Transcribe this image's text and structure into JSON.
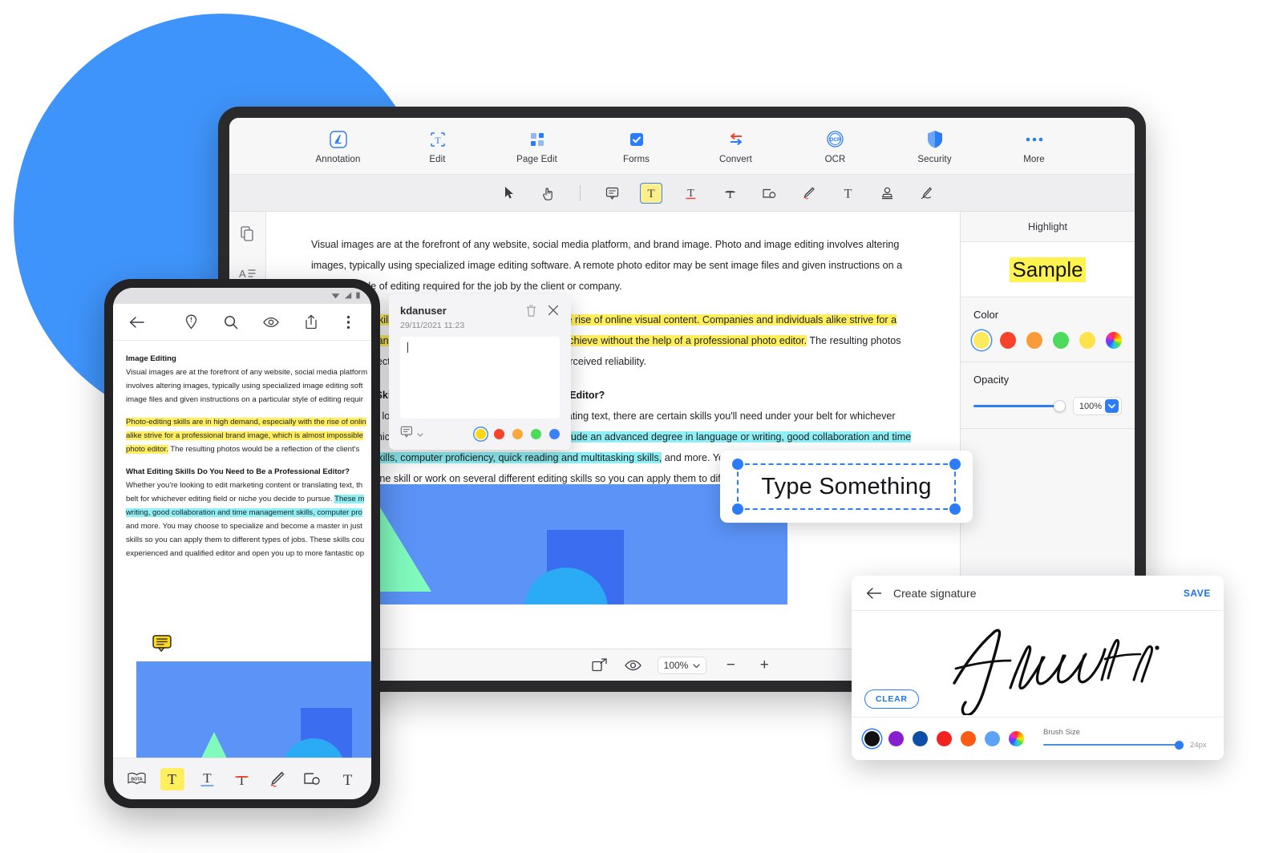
{
  "ribbon": {
    "items": [
      {
        "label": "Annotation",
        "icon": "annotation-icon",
        "active": true
      },
      {
        "label": "Edit",
        "icon": "edit-icon",
        "active": false
      },
      {
        "label": "Page Edit",
        "icon": "page-edit-icon",
        "active": false
      },
      {
        "label": "Forms",
        "icon": "forms-icon",
        "active": false
      },
      {
        "label": "Convert",
        "icon": "convert-icon",
        "active": false
      },
      {
        "label": "OCR",
        "icon": "ocr-icon",
        "active": false
      },
      {
        "label": "Security",
        "icon": "security-shield-icon",
        "active": false
      },
      {
        "label": "More",
        "icon": "more-dots-icon",
        "active": false
      }
    ]
  },
  "toolbar": {
    "tools": [
      "select-arrow-icon",
      "hand-icon",
      "separator",
      "sticky-note-icon",
      "highlight-text-icon",
      "underline-text-icon",
      "strikethrough-text-icon",
      "shapes-icon",
      "pencil-icon",
      "typewriter-icon",
      "stamp-icon",
      "signature-icon"
    ]
  },
  "left_rail": {
    "items": [
      "thumbnails-icon",
      "outline-icon"
    ]
  },
  "document": {
    "paragraph1": "Visual images are at the forefront of any website, social media platform, and brand image. Photo and image editing involves altering images, typically using specialized image editing software. A remote photo editor may be sent image files and given instructions on a particular style of editing required for the job by the client or company.",
    "paragraph2_hl1": "Photo-editing skills are in high demand, especially with the rise of online visual content. Companies and individuals alike strive for a professional brand image, which is almost impossible to achieve without the help of a professional photo editor.",
    "paragraph2_rest": " The resulting photos would be a reflection of the client's brand image and/or perceived reliability.",
    "heading2": "What Editing Skills Do You Need to Be a Professional Editor?",
    "paragraph3_a": "Whether you're looking to edit marketing content or translating text, there are certain skills you'll need under your belt for whichever editing field or niche you decide to pursue. ",
    "paragraph3_hl": "These may include an advanced degree in language or writing, good collaboration and time management skills, computer proficiency, quick reading and multitasking skills,",
    "paragraph3_b": " and more. You may choose to specialize and become a master in just one skill or work on several different editing skills so you can apply them to different types of jobs. These skills could be instrumental in proving that you're an experienced and qualified editor and open you up to more fantastic opportunities!",
    "note_pin": "sticky-note-pin-icon",
    "image_alt": "document-illustration"
  },
  "right_panel": {
    "title": "Highlight",
    "sample_text": "Sample",
    "color_label": "Color",
    "colors": [
      {
        "name": "yellow",
        "hex": "#ffe95c",
        "selected": true
      },
      {
        "name": "red",
        "hex": "#f8432c",
        "selected": false
      },
      {
        "name": "orange",
        "hex": "#f79c38",
        "selected": false
      },
      {
        "name": "green",
        "hex": "#4ddb5c",
        "selected": false
      },
      {
        "name": "light-yellow",
        "hex": "#ffe24a",
        "selected": false
      },
      {
        "name": "custom-rainbow",
        "hex": "rainbow",
        "selected": false
      }
    ],
    "opacity_label": "Opacity",
    "opacity_value": "100%",
    "opacity_percent": 100,
    "caret_icon": "chevron-down-icon"
  },
  "statusbar": {
    "fit_icon": "fit-page-icon",
    "view_icon": "eye-icon",
    "zoom_value": "100%",
    "zoom_caret": "chevron-down-icon",
    "minus": "−",
    "plus": "+"
  },
  "note_popup": {
    "user": "kdanuser",
    "date": "29/11/2021  11:23",
    "comment_value": "",
    "delete_icon": "trash-icon",
    "close_icon": "close-icon",
    "type_icon": "note-type-icon",
    "type_caret": "chevron-down-icon",
    "colors": [
      {
        "name": "yellow",
        "hex": "#ffd915",
        "selected": true
      },
      {
        "name": "red",
        "hex": "#f8432c",
        "selected": false
      },
      {
        "name": "orange",
        "hex": "#f7a93a",
        "selected": false
      },
      {
        "name": "green",
        "hex": "#4ddb5c",
        "selected": false
      },
      {
        "name": "blue",
        "hex": "#3b82f6",
        "selected": false
      }
    ]
  },
  "type_box": {
    "text": "Type Something",
    "handles": [
      "top-left",
      "top-right",
      "bottom-left",
      "bottom-right"
    ]
  },
  "signature_panel": {
    "back_icon": "back-arrow-icon",
    "title": "Create signature",
    "save_label": "SAVE",
    "clear_label": "CLEAR",
    "brush_label": "Brush Size",
    "brush_value": "24px",
    "brush_percent": 100,
    "colors": [
      {
        "name": "black",
        "hex": "#111111",
        "selected": true
      },
      {
        "name": "purple",
        "hex": "#8a1fd0",
        "selected": false
      },
      {
        "name": "navy",
        "hex": "#0f4ea8",
        "selected": false
      },
      {
        "name": "red",
        "hex": "#f42121",
        "selected": false
      },
      {
        "name": "orange",
        "hex": "#fb5b13",
        "selected": false
      },
      {
        "name": "light-blue",
        "hex": "#5da3f5",
        "selected": false
      },
      {
        "name": "custom-rainbow",
        "hex": "rainbow",
        "selected": false
      }
    ]
  },
  "phone": {
    "status": {
      "wifi": "wifi-icon",
      "signal": "signal-icon",
      "battery": "battery-icon"
    },
    "topbar_icons": [
      "back-arrow-icon",
      "bookmark-icon",
      "search-icon",
      "eye-icon",
      "share-icon",
      "overflow-menu-icon"
    ],
    "doc": {
      "heading": "Image Editing",
      "line1": "Visual images are at the forefront of any website, social media platform",
      "line2": "involves altering images, typically using specialized image editing soft",
      "line3": "image files and given instructions on a particular style of editing requir",
      "hl_line1": "Photo-editing skills are in high demand, especially with the rise of onlin",
      "hl_line2": "alike strive for a professional brand image, which is almost impossible",
      "hl_line3": "photo editor.",
      "after_hl3": " The resulting photos would be a reflection of the client's",
      "heading2": "What Editing Skills Do You Need to Be a Professional Editor?",
      "line4": "Whether you're looking to edit marketing content or translating text, th",
      "line5a": "belt for whichever editing field or niche you decide to pursue. ",
      "line5hl": "These m",
      "line6hl": "writing, good collaboration and time management skills, computer pro",
      "line7": "and more. You may choose to specialize and become a master in just",
      "line8": "skills so you can apply them to different types of jobs. These skills cou",
      "line9": "experienced and qualified editor and open you up to more fantastic op"
    },
    "toolbar": [
      {
        "icon": "bota-icon",
        "active": false
      },
      {
        "icon": "highlight-text-icon",
        "active": true
      },
      {
        "icon": "underline-text-icon",
        "active": false
      },
      {
        "icon": "strikethrough-text-icon",
        "active": false
      },
      {
        "icon": "pencil-icon",
        "active": false
      },
      {
        "icon": "shapes-icon",
        "active": false
      },
      {
        "icon": "typewriter-icon",
        "active": false
      }
    ]
  },
  "theme": {
    "accent_blue": "#3f94fb",
    "highlight_yellow": "#ffef5e",
    "highlight_cyan": "#8ef0f5",
    "frame_dark": "#2b2b2d"
  }
}
